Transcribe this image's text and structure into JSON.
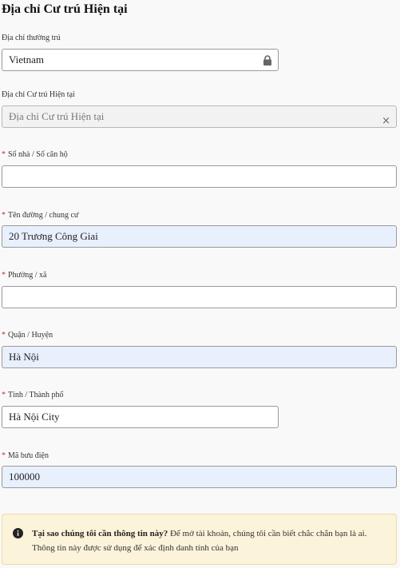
{
  "section_title": "Địa chỉ Cư trú Hiện tại",
  "required_mark": "*",
  "fields": {
    "permanent_address": {
      "label": "Địa chỉ thường trú",
      "value": "Vietnam",
      "icon": "lock-icon"
    },
    "current_address": {
      "label": "Địa chỉ Cư trú Hiện tại",
      "placeholder": "Địa chỉ Cư trú Hiện tại",
      "clear_icon": "×"
    },
    "house_number": {
      "label": "Số nhà / Số căn hộ",
      "value": ""
    },
    "street": {
      "label": "Tên đường / chung cư",
      "value": "20 Trương Công Giai"
    },
    "ward": {
      "label": "Phường / xã",
      "value": ""
    },
    "district": {
      "label": "Quận / Huyện",
      "value": "Hà Nội"
    },
    "province": {
      "label": "Tỉnh / Thành phố",
      "value": "Hà Nội City"
    },
    "postal_code": {
      "label": "Mã bưu điện",
      "value": "100000"
    }
  },
  "notice": {
    "icon": "info-icon",
    "question": "Tại sao chúng tôi cần thông tin này?",
    "text": " Để mở tài khoản, chúng tôi cần biết chắc chắn bạn là ai. Thông tin này được sử dụng để xác định danh tính của bạn"
  },
  "colors": {
    "required": "#c0392b",
    "autofill_bg": "#e8f0fe",
    "notice_bg": "#fbf3da",
    "notice_border": "#eed9a3"
  }
}
